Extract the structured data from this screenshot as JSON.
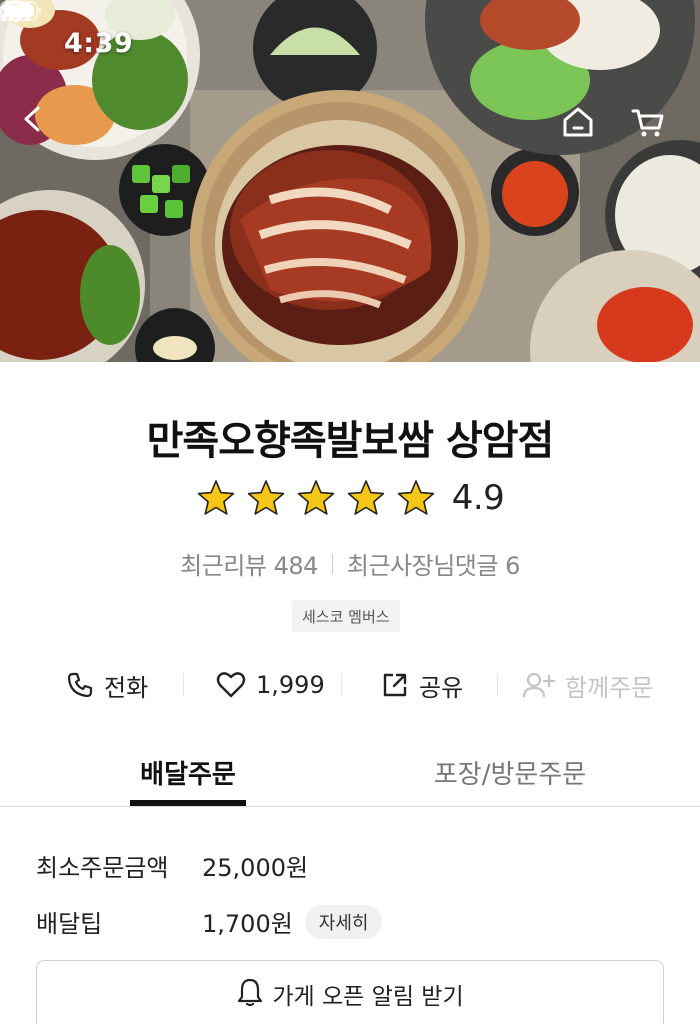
{
  "status_bar": {
    "time": "4:39"
  },
  "store": {
    "name": "만족오향족발보쌈 상암점",
    "rating": "4.9",
    "star_count": 5,
    "recent_reviews": "최근리뷰 484",
    "owner_replies": "최근사장님댓글 6",
    "badge": "세스코 멤버스"
  },
  "actions": {
    "call": "전화",
    "likes": "1,999",
    "share": "공유",
    "group_order": "함께주문"
  },
  "tabs": [
    {
      "label": "배달주문",
      "active": true
    },
    {
      "label": "포장/방문주문",
      "active": false
    }
  ],
  "order_info": {
    "min_order_label": "최소주문금액",
    "min_order_value": "25,000원",
    "delivery_tip_label": "배달팁",
    "delivery_tip_value": "1,700원",
    "detail_label": "자세히"
  },
  "notify_button": "가게 오픈 알림 받기",
  "colors": {
    "star": "#f5c518",
    "text_primary": "#222222",
    "text_muted": "#888888",
    "disabled": "#c4c4c4"
  },
  "icons": [
    "back-arrow-icon",
    "home-icon",
    "cart-icon",
    "phone-icon",
    "heart-icon",
    "share-icon",
    "add-person-icon",
    "bell-icon",
    "star-icon"
  ]
}
